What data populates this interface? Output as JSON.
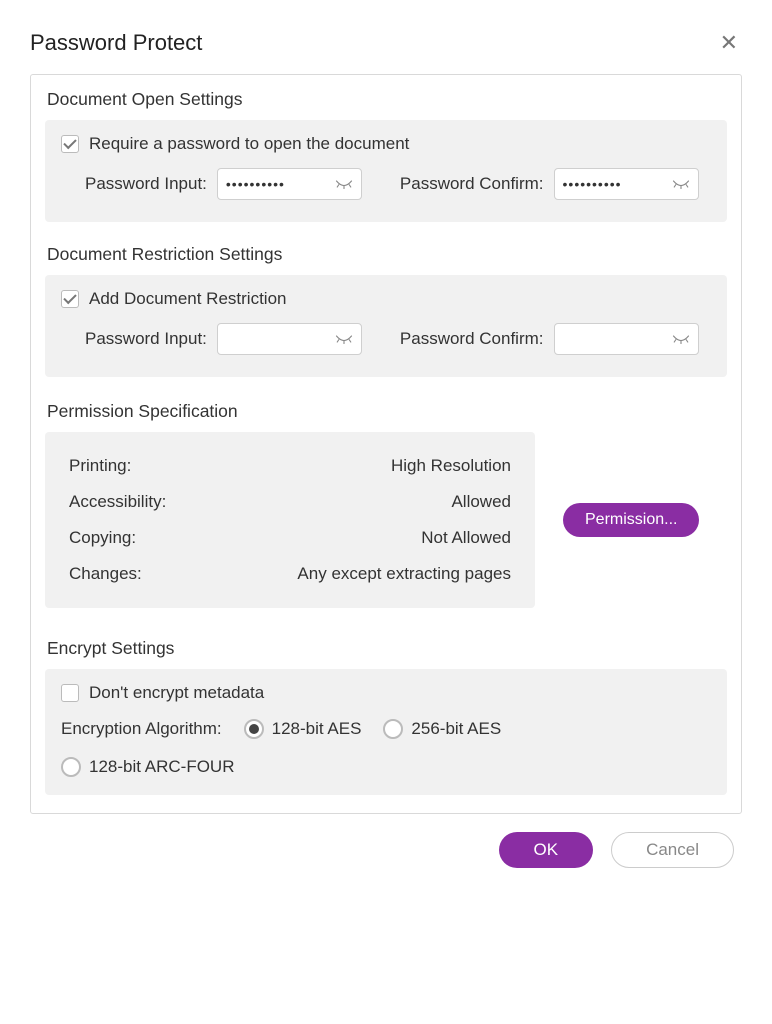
{
  "dialog": {
    "title": "Password Protect"
  },
  "open_settings": {
    "title": "Document Open Settings",
    "require_label": "Require a password to open the document",
    "require_checked": true,
    "pw_input_label": "Password Input:",
    "pw_input_value": "••••••••••",
    "pw_confirm_label": "Password Confirm:",
    "pw_confirm_value": "••••••••••"
  },
  "restriction_settings": {
    "title": "Document Restriction Settings",
    "add_label": "Add Document Restriction",
    "add_checked": true,
    "pw_input_label": "Password Input:",
    "pw_input_value": "",
    "pw_confirm_label": "Password Confirm:",
    "pw_confirm_value": ""
  },
  "permission": {
    "title": "Permission Specification",
    "rows": {
      "printing_key": "Printing:",
      "printing_val": "High Resolution",
      "accessibility_key": "Accessibility:",
      "accessibility_val": "Allowed",
      "copying_key": "Copying:",
      "copying_val": "Not Allowed",
      "changes_key": "Changes:",
      "changes_val": "Any except extracting pages"
    },
    "button_label": "Permission..."
  },
  "encrypt": {
    "title": "Encrypt Settings",
    "dont_encrypt_label": "Don't encrypt metadata",
    "dont_encrypt_checked": false,
    "algorithm_label": "Encryption Algorithm:",
    "opt_128_aes": "128-bit AES",
    "opt_256_aes": "256-bit AES",
    "opt_128_arcfour": "128-bit ARC-FOUR",
    "selected": "128-bit AES"
  },
  "footer": {
    "ok": "OK",
    "cancel": "Cancel"
  }
}
